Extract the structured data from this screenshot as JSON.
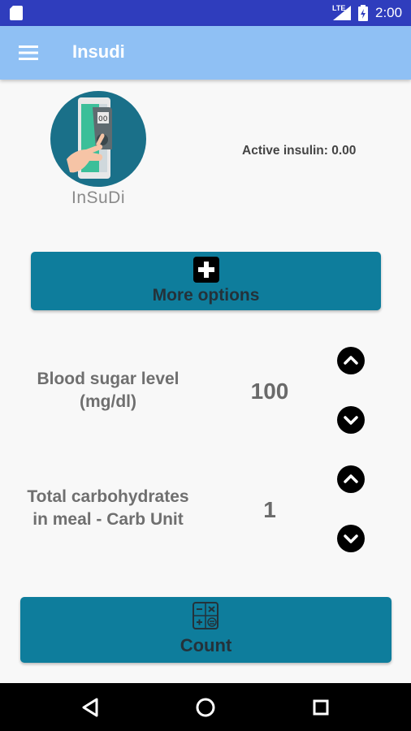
{
  "status_bar": {
    "time": "2:00",
    "network": "LTE",
    "icons": [
      "sd-card-icon",
      "signal-icon",
      "battery-icon"
    ]
  },
  "app_bar": {
    "title": "Insudi",
    "menu_icon": "hamburger-menu-icon"
  },
  "logo": {
    "text": "InSuDi"
  },
  "active_insulin": {
    "text": "Active insulin:  0.00"
  },
  "more_options": {
    "label": "More options",
    "icon": "plus-box-icon"
  },
  "blood_sugar": {
    "label_line1": "Blood sugar level",
    "label_line2": "(mg/dl)",
    "value": "100"
  },
  "carbs": {
    "label_line1": "Total carbohydrates",
    "label_line2": "in meal - Carb Unit",
    "value": "1"
  },
  "count": {
    "label": "Count",
    "icon": "calculator-icon"
  },
  "colors": {
    "status_bar": "#2f3dbd",
    "app_bar": "#8fc0f4",
    "button": "#0e7d9c",
    "background": "#f8f8f8"
  }
}
